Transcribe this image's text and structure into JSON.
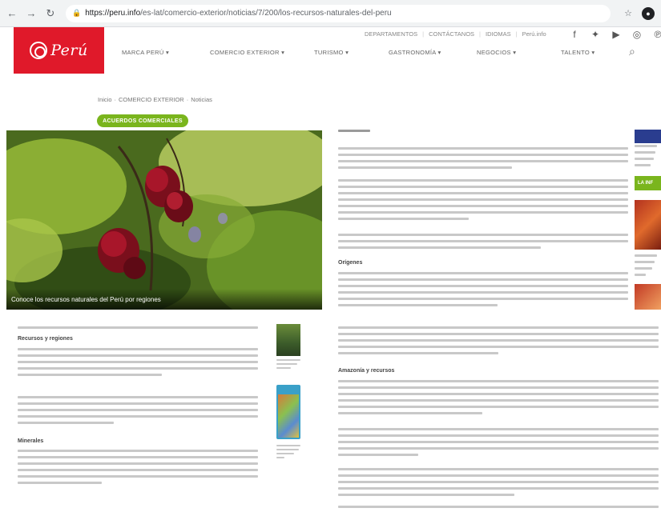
{
  "browser": {
    "url_host": "https://peru.info",
    "url_path": "/es-lat/comercio-exterior/noticias/7/200/los-recursos-naturales-del-peru"
  },
  "site": {
    "logo_text": "Perú",
    "topbar": {
      "items": [
        "DEPARTAMENTOS",
        "CONTÁCTANOS",
        "IDIOMAS",
        "Perú.info"
      ],
      "separators": [
        "|",
        "|",
        "|"
      ]
    },
    "social_icons": [
      "facebook-icon",
      "twitter-icon",
      "youtube-icon",
      "instagram-icon",
      "pinterest-icon"
    ],
    "nav": [
      "MARCA PERÚ",
      "COMERCIO EXTERIOR",
      "TURISMO",
      "GASTRONOMÍA",
      "NEGOCIOS",
      "TALENTO"
    ]
  },
  "breadcrumb": [
    "Inicio",
    "COMERCIO EXTERIOR",
    "Noticias"
  ],
  "tag": "ACUERDOS COMERCIALES",
  "hero": {
    "caption": "Conoce los recursos naturales del Perú por regiones"
  },
  "right_column": {
    "heading_origins": "Orígenes",
    "ad_green_label": "LA INF"
  },
  "left_column": {
    "heading_1": "Recursos y regiones",
    "heading_2": "Minerales"
  },
  "right_lower": {
    "heading_1": "Amazonía y recursos"
  },
  "colors": {
    "brand_red": "#e0192a",
    "tag_green": "#7ab51d"
  }
}
